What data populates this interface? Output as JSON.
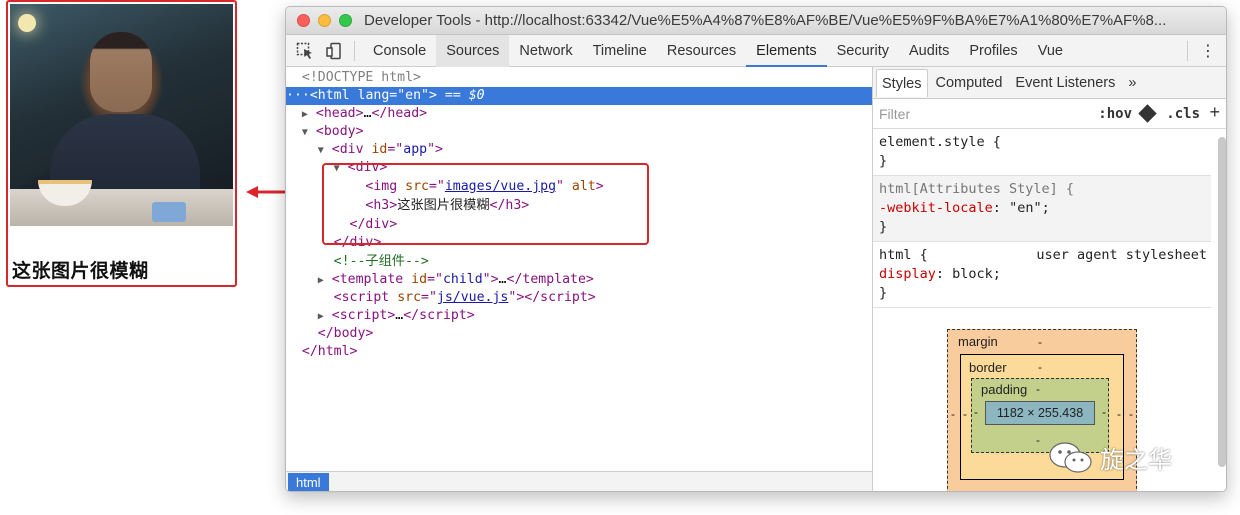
{
  "preview": {
    "heading": "这张图片很模糊",
    "photo_alt": ""
  },
  "window": {
    "title": "Developer Tools - http://localhost:63342/Vue%E5%A4%87%E8%AF%BE/Vue%E5%9F%BA%E7%A1%80%E7%AF%8..."
  },
  "toolbar": {
    "tabs": [
      {
        "label": "Console"
      },
      {
        "label": "Sources"
      },
      {
        "label": "Network"
      },
      {
        "label": "Timeline"
      },
      {
        "label": "Resources"
      },
      {
        "label": "Elements"
      },
      {
        "label": "Security"
      },
      {
        "label": "Audits"
      },
      {
        "label": "Profiles"
      },
      {
        "label": "Vue"
      }
    ],
    "active_tab": "Elements",
    "more_label": "⋮"
  },
  "elements": {
    "doctype": "<!DOCTYPE html>",
    "html_open": "html",
    "html_lang_attr": "lang",
    "html_lang_val": "en",
    "selected_marker": "== $0",
    "head_tag": "head",
    "body_tag": "body",
    "div_app_tag": "div",
    "div_app_attr": "id",
    "div_app_val": "app",
    "div_tag": "div",
    "img_tag": "img",
    "img_src_attr": "src",
    "img_src_val": "images/vue.jpg",
    "img_alt_attr": "alt",
    "h3_tag": "h3",
    "h3_text": "这张图片很模糊",
    "comment": "<!--子组件-->",
    "template_tag": "template",
    "template_attr": "id",
    "template_val": "child",
    "script_tag": "script",
    "script_src_attr": "src",
    "script_src_val": "js/vue.js",
    "breadcrumb": "html"
  },
  "styles": {
    "tabs": [
      {
        "label": "Styles"
      },
      {
        "label": "Computed"
      },
      {
        "label": "Event Listeners"
      }
    ],
    "more_tabs": "»",
    "filter_placeholder": "Filter",
    "hov_label": ":hov",
    "cls_label": ".cls",
    "add_label": "+",
    "rules": {
      "element_style": "element.style {",
      "attr_selector": "html[Attributes Style] {",
      "attr_prop": "-webkit-locale",
      "attr_val": "\"en\";",
      "html_selector": "html {",
      "ua_label": "user agent stylesheet",
      "html_prop": "display",
      "html_val": "block;",
      "close": "}"
    },
    "box_model": {
      "margin_label": "margin",
      "border_label": "border",
      "padding_label": "padding",
      "content_size": "1182 × 255.438",
      "dash": "-"
    }
  },
  "watermark": {
    "text": "旋之华"
  },
  "colors": {
    "highlight": "#d8262b",
    "selection": "#3879d9",
    "tag": "#881280",
    "attr": "#994500",
    "value": "#1a1aa6",
    "comment": "#236e25"
  }
}
